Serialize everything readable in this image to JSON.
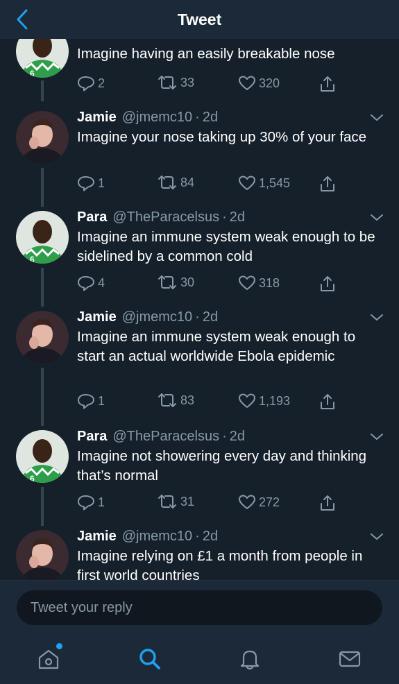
{
  "header": {
    "title": "Tweet"
  },
  "colors": {
    "accent": "#1da1f2",
    "background": "#15202b",
    "muted": "#8899a6",
    "bar": "#1c2938"
  },
  "tweets": [
    {
      "name": "",
      "handle": "",
      "time": "",
      "text": "Imagine having an easily breakable nose",
      "replies": "2",
      "retweets": "33",
      "likes": "320",
      "avatar": "para"
    },
    {
      "name": "Jamie",
      "handle": "@jmemc10",
      "time": "2d",
      "text": "Imagine your nose taking up 30% of your face",
      "replies": "1",
      "retweets": "84",
      "likes": "1,545",
      "avatar": "jamie"
    },
    {
      "name": "Para",
      "handle": "@TheParacelsus",
      "time": "2d",
      "text": "Imagine an immune system weak enough to be sidelined by a common cold",
      "replies": "4",
      "retweets": "30",
      "likes": "318",
      "avatar": "para"
    },
    {
      "name": "Jamie",
      "handle": "@jmemc10",
      "time": "2d",
      "text": "Imagine an immune system weak enough to start an actual worldwide Ebola epidemic",
      "replies": "1",
      "retweets": "83",
      "likes": "1,193",
      "avatar": "jamie"
    },
    {
      "name": "Para",
      "handle": "@TheParacelsus",
      "time": "2d",
      "text": "Imagine not showering every day and thinking that’s normal",
      "replies": "1",
      "retweets": "31",
      "likes": "272",
      "avatar": "para"
    },
    {
      "name": "Jamie",
      "handle": "@jmemc10",
      "time": "2d",
      "text": "Imagine relying on £1 a month from people in first world countries",
      "replies": "",
      "retweets": "",
      "likes": "",
      "avatar": "jamie"
    }
  ],
  "compose": {
    "placeholder": "Tweet your reply"
  },
  "tabbar": {
    "icons": [
      "home-icon",
      "search-icon",
      "notifications-icon",
      "messages-icon"
    ],
    "active": "search-icon"
  }
}
